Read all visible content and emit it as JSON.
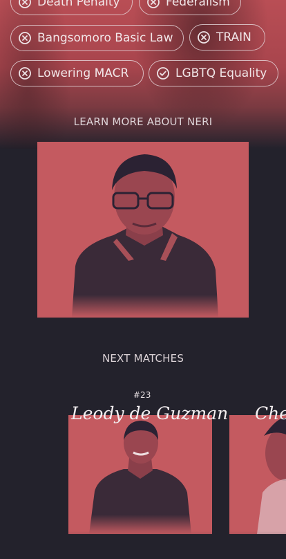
{
  "chips": [
    {
      "label": "Death Penalty",
      "status": "disagree",
      "icon": "x-circle-icon"
    },
    {
      "label": "Federalism",
      "status": "disagree",
      "icon": "x-circle-icon"
    },
    {
      "label": "Bangsomoro Basic Law",
      "status": "disagree",
      "icon": "x-circle-icon"
    },
    {
      "label": "TRAIN",
      "status": "disagree",
      "icon": "x-circle-icon"
    },
    {
      "label": "Lowering MACR",
      "status": "disagree",
      "icon": "x-circle-icon"
    },
    {
      "label": "LGBTQ Equality",
      "status": "agree",
      "icon": "check-circle-icon"
    }
  ],
  "learn_more": {
    "title": "LEARN MORE ABOUT NERI"
  },
  "next_matches": {
    "title": "NEXT MATCHES",
    "items": [
      {
        "rank": "#23",
        "name": "Leody de Guzman"
      },
      {
        "name": "Chel"
      }
    ]
  },
  "colors": {
    "background": "#23222c",
    "accent": "#c45a60",
    "chip_border": "#e8dce0"
  }
}
